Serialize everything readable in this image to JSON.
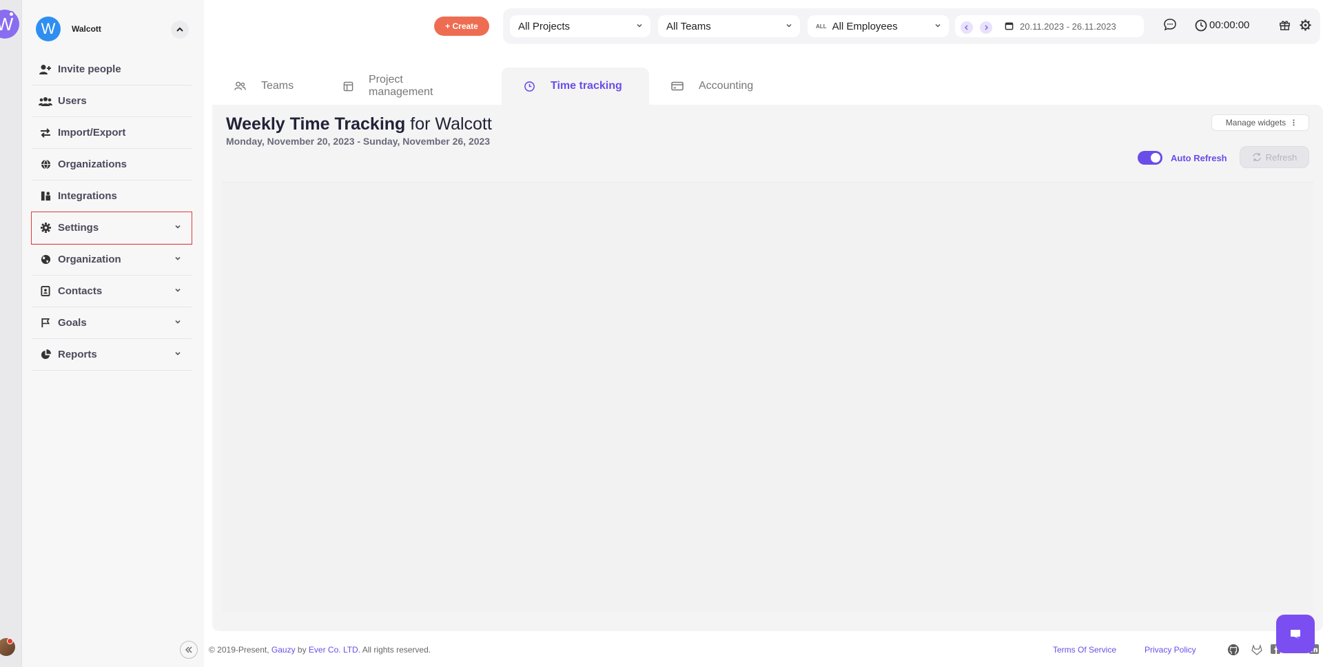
{
  "rail": {
    "logo_letter": "W"
  },
  "sidebar": {
    "org_avatar_letter": "W",
    "org_name": "Walcott",
    "items": [
      {
        "label": "Invite people",
        "icon": "user-plus-icon"
      },
      {
        "label": "Users",
        "icon": "users-icon"
      },
      {
        "label": "Import/Export",
        "icon": "swap-arrows-icon"
      },
      {
        "label": "Organizations",
        "icon": "globe-icon"
      },
      {
        "label": "Integrations",
        "icon": "puzzle-icon"
      },
      {
        "label": "Settings",
        "icon": "gear-icon",
        "expandable": true,
        "highlighted": true
      },
      {
        "label": "Organization",
        "icon": "globe-filled-icon",
        "expandable": true
      },
      {
        "label": "Contacts",
        "icon": "contact-book-icon",
        "expandable": true
      },
      {
        "label": "Goals",
        "icon": "flag-icon",
        "expandable": true
      },
      {
        "label": "Reports",
        "icon": "pie-chart-icon",
        "expandable": true
      }
    ]
  },
  "header": {
    "create_label": "+ Create",
    "projects_value": "All Projects",
    "teams_value": "All Teams",
    "employees_tag": "ALL",
    "employees_value": "All Employees",
    "date_range": "20.11.2023 - 26.11.2023",
    "timer": "00:00:00"
  },
  "tabs": [
    {
      "label": "Teams",
      "icon": "people-icon"
    },
    {
      "label": "Project management",
      "icon": "calendar-board-icon"
    },
    {
      "label": "Time tracking",
      "icon": "clock-icon",
      "active": true
    },
    {
      "label": "Accounting",
      "icon": "card-icon"
    }
  ],
  "main": {
    "title_bold": "Weekly Time Tracking",
    "title_rest": " for Walcott",
    "subtitle": "Monday, November 20, 2023 - Sunday, November 26, 2023",
    "manage_widgets": "Manage widgets",
    "auto_refresh_label": "Auto Refresh",
    "auto_refresh_on": true,
    "refresh_label": "Refresh"
  },
  "footer": {
    "copy_prefix": "© 2019-Present, ",
    "brand": "Gauzy",
    "by": " by ",
    "company": "Ever Co. LTD.",
    "rights": " All rights reserved.",
    "terms": "Terms Of Service",
    "privacy": "Privacy Policy"
  },
  "colors": {
    "accent": "#6a4ce8",
    "create": "#ee6d52",
    "highlight": "#e0393b"
  }
}
